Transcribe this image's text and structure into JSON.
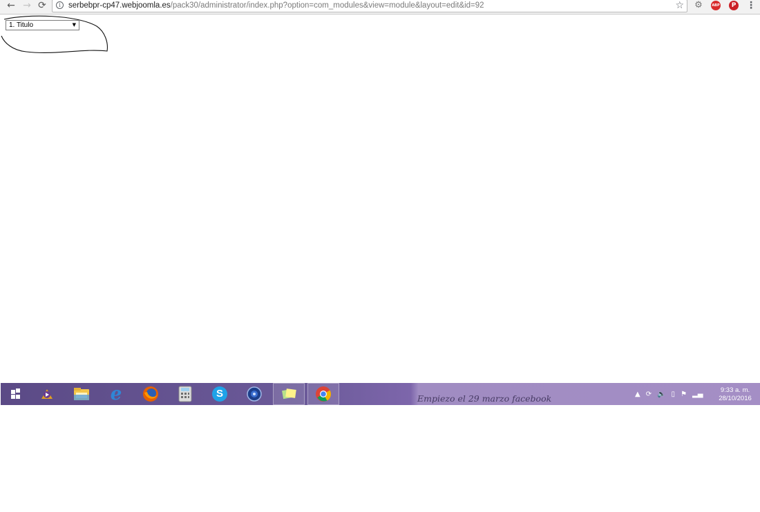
{
  "browser": {
    "url_host": "serbebpr-cp47.webjoomla.es",
    "url_path": "/pack30/administrator/index.php?option=com_modules&view=module&layout=edit&id=92",
    "extensions": {
      "abp_label": "ABP",
      "pinterest_label": "P"
    }
  },
  "page": {
    "dropdown": {
      "selected": "1. Titulo"
    }
  },
  "taskbar": {
    "pinned": [
      "start-icon",
      "media-player-icon",
      "file-explorer-icon",
      "internet-explorer-icon",
      "firefox-icon",
      "calculator-icon",
      "skype-icon",
      "app-globe-icon",
      "sticky-notes-icon",
      "chrome-icon"
    ],
    "wallpaper_text": "Empiezo el 29 marzo facebook",
    "clock": {
      "time": "9:33 a. m.",
      "date": "28/10/2016"
    }
  },
  "colors": {
    "taskbar_left": "#5b4a86",
    "taskbar_right": "#a48ec5",
    "annotation_stroke": "#111111"
  }
}
